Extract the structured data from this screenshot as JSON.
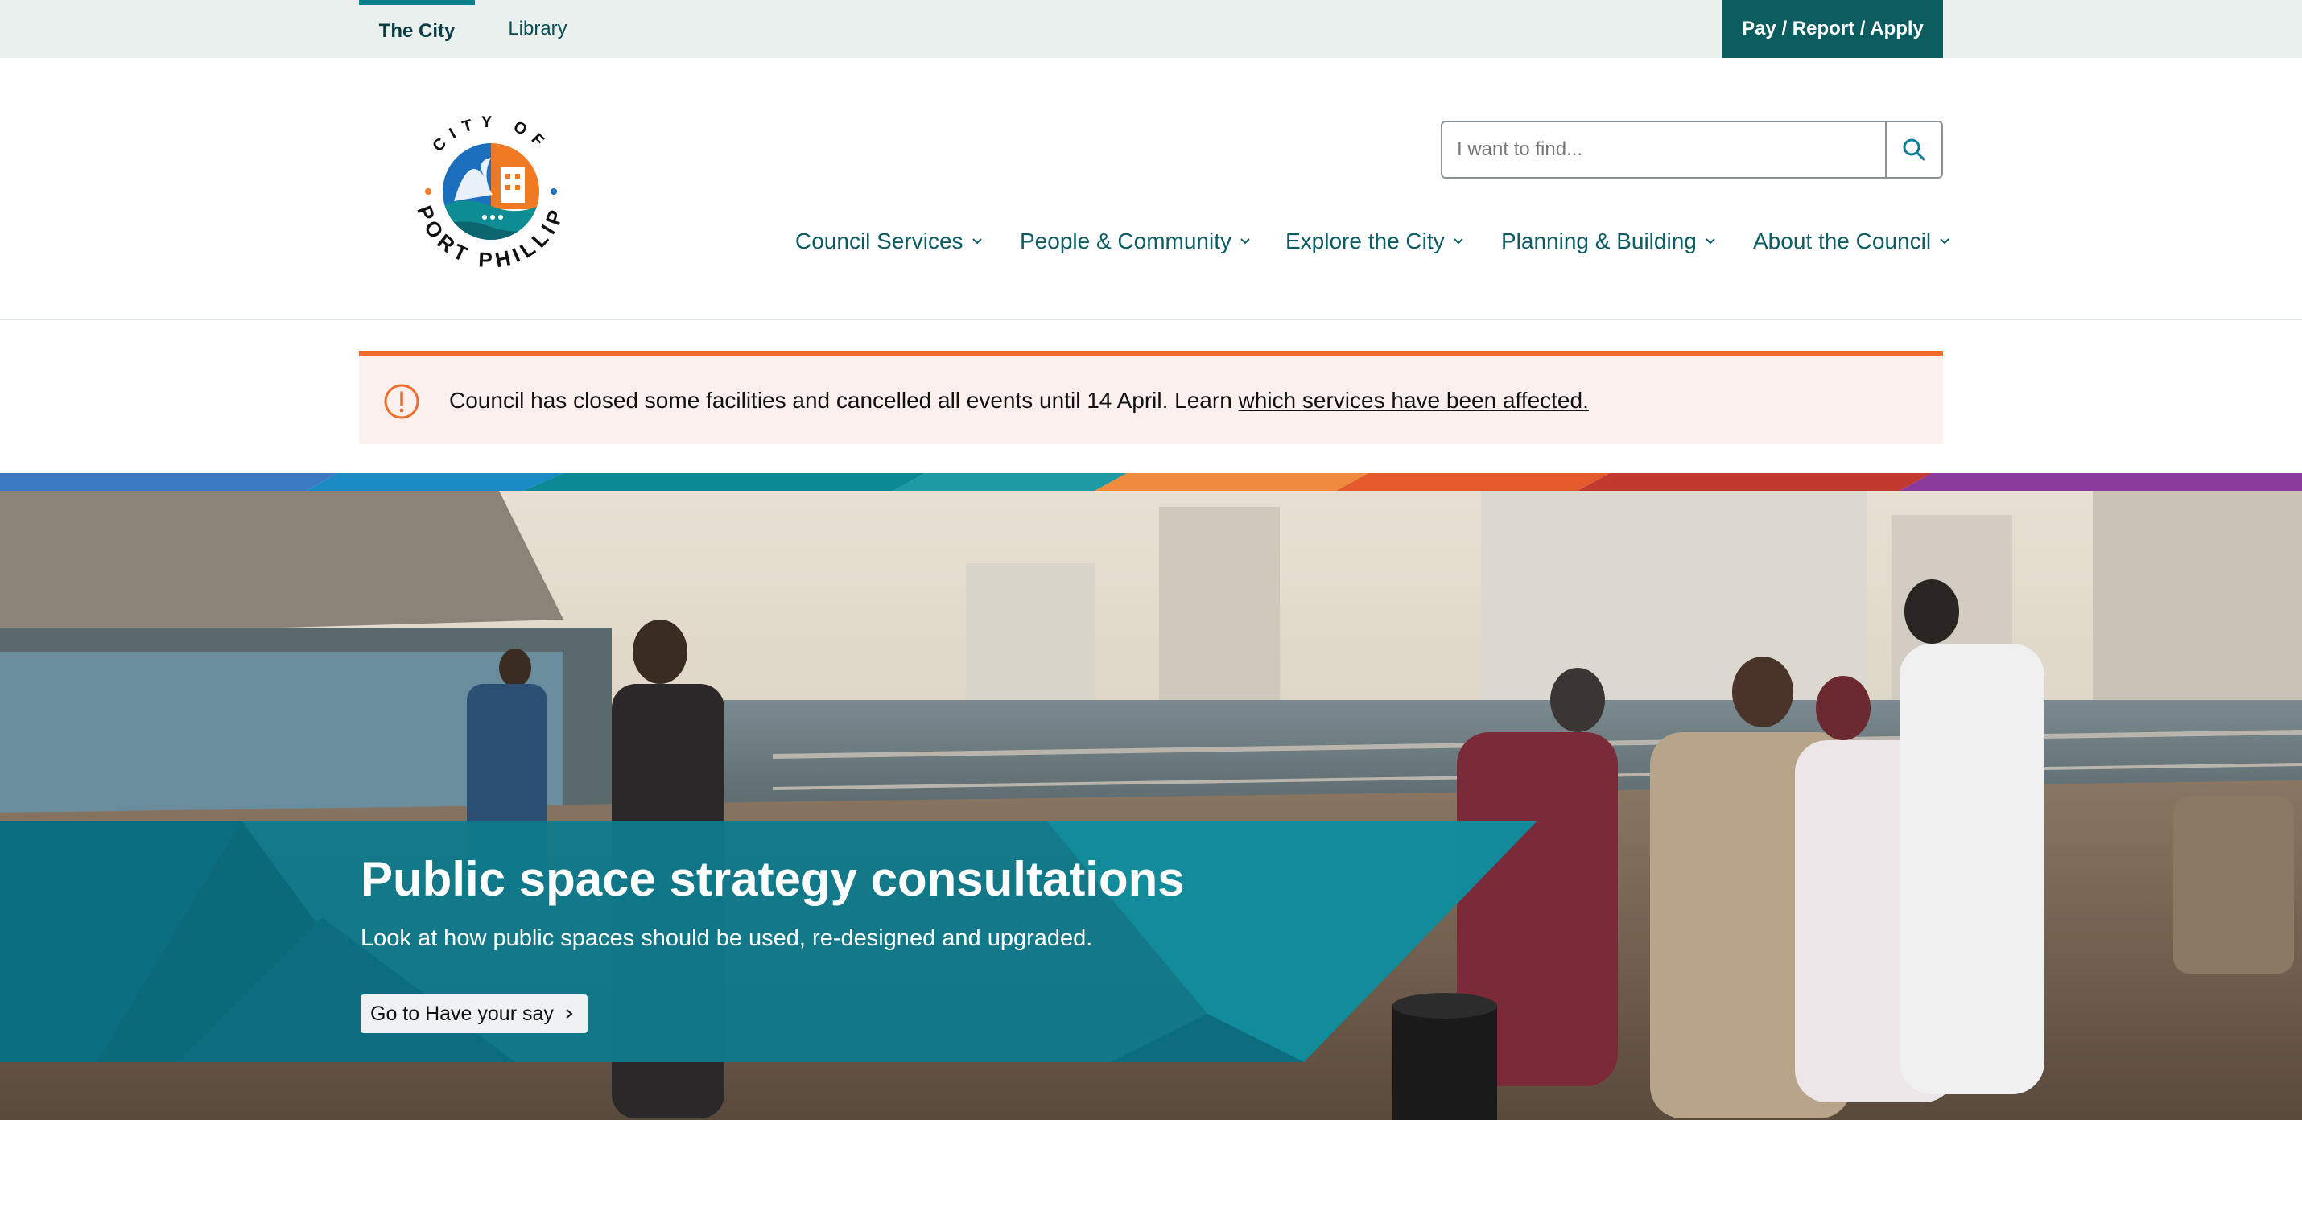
{
  "utility_bar": {
    "tabs": [
      {
        "label": "The City",
        "active": true
      },
      {
        "label": "Library",
        "active": false
      }
    ],
    "action_label": "Pay / Report / Apply"
  },
  "logo": {
    "text_top": "CITY OF",
    "text_bottom": "PORT PHILLIP"
  },
  "search": {
    "placeholder": "I want to find..."
  },
  "nav": {
    "items": [
      {
        "label": "Council Services"
      },
      {
        "label": "People & Community"
      },
      {
        "label": "Explore the City"
      },
      {
        "label": "Planning & Building"
      },
      {
        "label": "About the Council"
      }
    ]
  },
  "alert": {
    "text": "Council has closed some facilities and cancelled all events until 14 April. Learn ",
    "link": "which services have been affected."
  },
  "hero": {
    "title": "Public space strategy consultations",
    "subtitle": "Look at how public spaces should be used, re-designed and upgraded.",
    "button_label": "Go to Have your say"
  },
  "colors": {
    "brand_teal": "#0b5d5f",
    "nav_teal": "#0b5d63",
    "alert_orange": "#ef6c2a",
    "hero_panel": "#0e7a8c"
  },
  "icons": [
    "search-icon",
    "alert-icon",
    "chevron-down-icon",
    "chevron-right-icon"
  ]
}
